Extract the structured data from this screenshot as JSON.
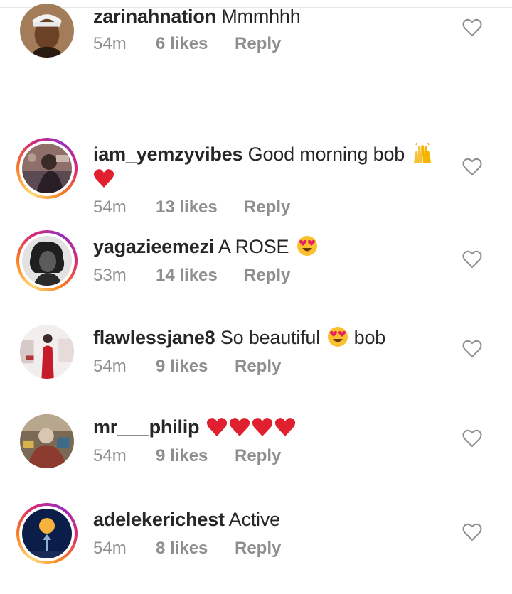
{
  "comments": [
    {
      "username": "iam_yemzyvibes",
      "text": "Good morning bob",
      "time": "54m",
      "likes": "13 likes",
      "reply": "Reply",
      "emojis": [
        "raising-hands",
        "red-heart"
      ],
      "story_ring": true
    },
    {
      "username": "yagazieemezi",
      "text": "A ROSE",
      "time": "53m",
      "likes": "14 likes",
      "reply": "Reply",
      "emojis": [
        "heart-eyes"
      ],
      "story_ring": true
    },
    {
      "username": "flawlessjane8",
      "text": "So beautiful",
      "text_after": "bob",
      "time": "54m",
      "likes": "9 likes",
      "reply": "Reply",
      "emojis": [
        "heart-eyes"
      ],
      "story_ring": false
    },
    {
      "username": "mr___philip",
      "text": "",
      "time": "54m",
      "likes": "9 likes",
      "reply": "Reply",
      "emojis": [
        "red-heart",
        "red-heart",
        "red-heart",
        "red-heart"
      ],
      "story_ring": false
    },
    {
      "username": "adelekerichest",
      "text": "Active",
      "time": "54m",
      "likes": "8 likes",
      "reply": "Reply",
      "emojis": [],
      "story_ring": true
    },
    {
      "username": "zarinahnation",
      "text": "Mmmhhh",
      "time": "54m",
      "likes": "6 likes",
      "reply": "Reply",
      "emojis": [],
      "story_ring": false
    }
  ],
  "icons": {
    "like": "heart-outline-icon"
  },
  "colors": {
    "username": "#262626",
    "meta": "#8e8e8e",
    "heart": "#e0202f",
    "like_outline": "#8e8e8e"
  }
}
